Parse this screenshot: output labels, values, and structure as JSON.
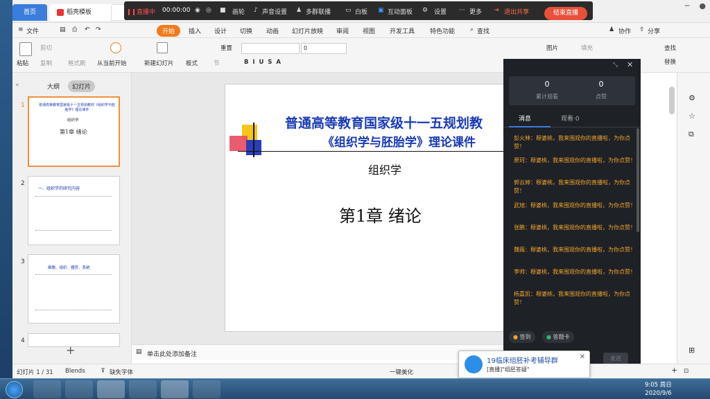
{
  "tabs": {
    "home": "首页",
    "template": "稻壳模板"
  },
  "livebar": {
    "status": "直播中",
    "timer": "00:00:00",
    "items": [
      "画轮",
      "声音设置",
      "多群联播",
      "白板",
      "互动面板",
      "设置",
      "更多"
    ],
    "exit_share": "退出共享",
    "end_live": "结束直播"
  },
  "menu": {
    "file": "文件",
    "items": [
      "开始",
      "插入",
      "设计",
      "切换",
      "动画",
      "幻灯片放映",
      "审阅",
      "视图",
      "开发工具",
      "特色功能",
      "查找"
    ],
    "collab": "协作",
    "share": "分享"
  },
  "ribbon": {
    "paste": "粘贴",
    "cut": "剪切",
    "copy": "复制",
    "format_painter": "格式刷",
    "play_from_current": "从当前开始",
    "new_slide": "新建幻灯片",
    "layout": "板式",
    "section": "节",
    "reset": "重置",
    "font_size": "0",
    "picture": "图片",
    "fill": "填充",
    "find": "查找",
    "replace": "替换"
  },
  "leftpanel": {
    "outline_tab": "大纲",
    "slides_tab": "幻灯片",
    "thumbs": [
      {
        "num": "1",
        "title": "普通高等教育国家级十一五规划教材《组织学与胚胎学》理论课件",
        "sub": "组织学",
        "chapter": "第1章 绪论"
      },
      {
        "num": "2",
        "title": "一、组织学的研究内容"
      },
      {
        "num": "3",
        "title": "细胞、组织、器官、系统"
      },
      {
        "num": "4",
        "title": ""
      }
    ]
  },
  "slide": {
    "title1": "普通高等教育国家级十一五规划教",
    "title2": "《组织学与胚胎学》理论课件",
    "subtitle": "组织学",
    "chapter": "第1章  绪论"
  },
  "notes_placeholder": "单击此处添加备注",
  "livepanel": {
    "stats": [
      {
        "value": "0",
        "label": "累计观看"
      },
      {
        "value": "0",
        "label": "点赞"
      }
    ],
    "tab_messages": "消息",
    "tab_viewers": "观看·0",
    "messages": [
      "彭火林：穆婆桃，我来围观你的直播啦，为你点赞！",
      "原珂：穆婆桃，我来围观你的直播啦，为你点赞！",
      "郭云婷：穆婆桃，我来围观你的直播啦，为你点赞！",
      "武旭：穆婆桃，我来围观你的直播啦，为你点赞！",
      "张鹏：穆婆桃，我来围观你的直播啦，为你点赞！",
      "魏薇：穆婆桃，我来围观你的直播啦，为你点赞！",
      "李帅：穆婆桃，我来围观你的直播啦，为你点赞！",
      "杨嘉凯：穆婆桃，我来围观你的直播啦，为你点赞！"
    ],
    "checkin": "签到",
    "answer_card": "答题卡",
    "send": "发送"
  },
  "statusbar": {
    "slide_info": "幻灯片 1 / 31",
    "theme": "Blends",
    "missing_font": "缺失字体",
    "beautify": "一键美化"
  },
  "notification": {
    "title": "19临床组胚补考辅导群",
    "body": "[直播]\"组胚答疑\""
  },
  "clock": {
    "time": "9:05 周日",
    "date": "2020/9/6"
  },
  "colors": {
    "accent": "#f27a1a",
    "live_red": "#e8503a",
    "message": "#f0a32e",
    "slide_title": "#1a3bb5"
  }
}
